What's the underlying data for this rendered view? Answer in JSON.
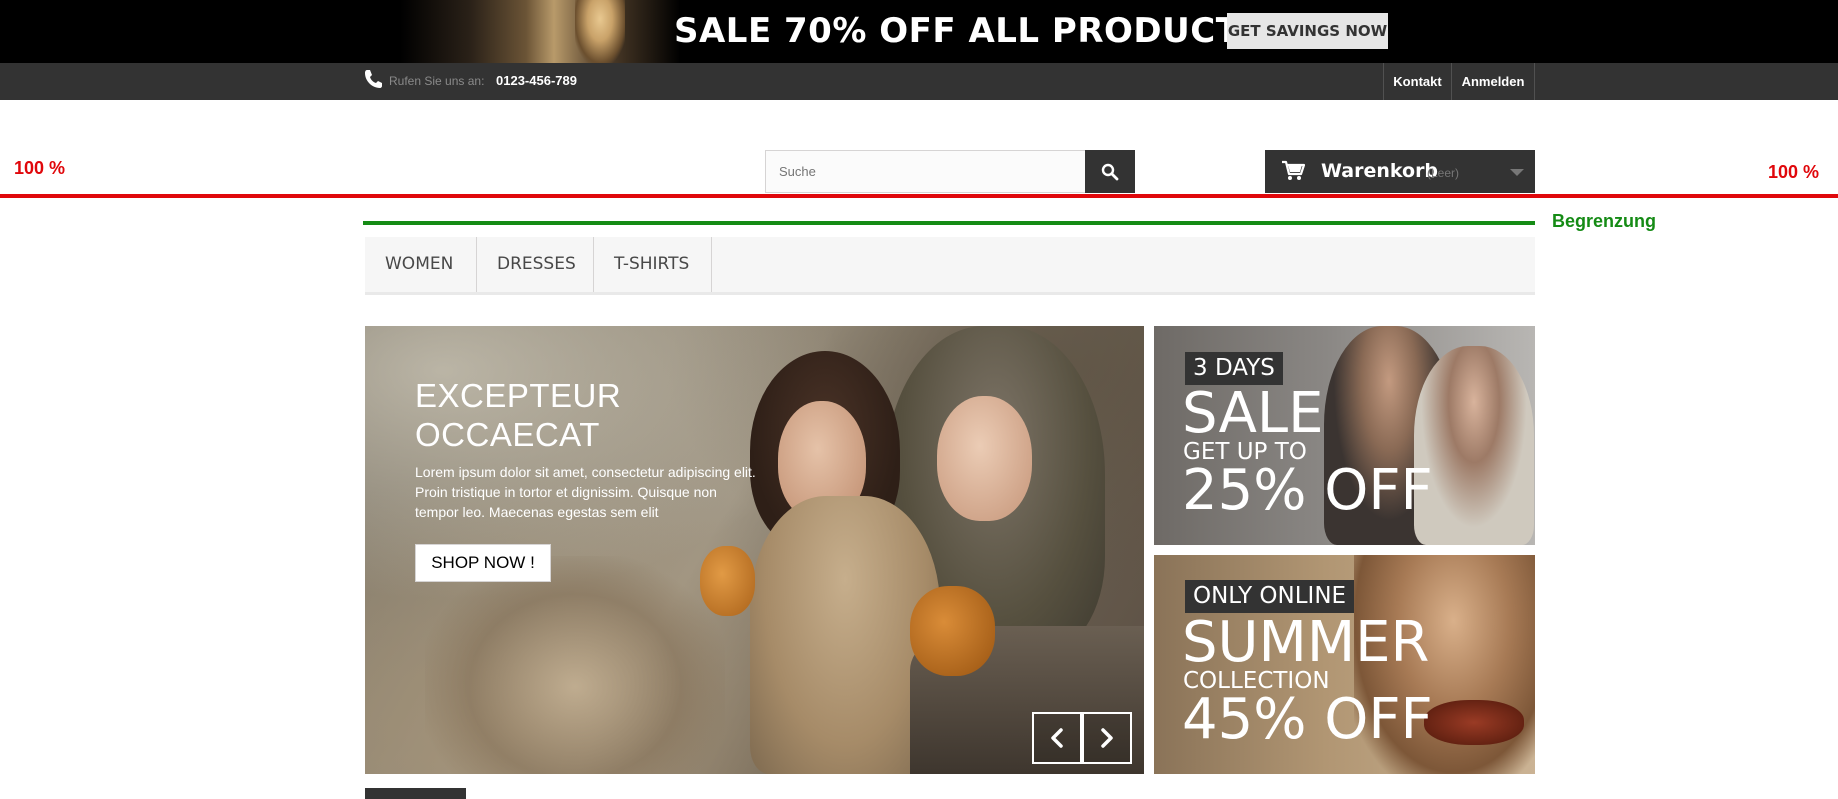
{
  "promo_banner": {
    "headline": "SALE 70% OFF ALL PRODUCTS",
    "button_label": "GET SAVINGS NOW"
  },
  "header_bar": {
    "call_label": "Rufen Sie uns an:",
    "phone_number": "0123-456-789",
    "links": [
      {
        "label": "Kontakt"
      },
      {
        "label": "Anmelden"
      }
    ]
  },
  "search": {
    "placeholder": "Suche",
    "value": ""
  },
  "cart": {
    "label": "Warenkorb",
    "status": "(Leer)"
  },
  "annotations": {
    "left_percent": "100 %",
    "right_percent": "100 %",
    "limit_label": "Begrenzung",
    "red_color": "#e0070b",
    "green_color": "#158b15"
  },
  "menu": {
    "items": [
      {
        "label": "WOMEN"
      },
      {
        "label": "DRESSES"
      },
      {
        "label": "T-SHIRTS"
      }
    ]
  },
  "hero": {
    "title_line1": "EXCEPTEUR",
    "title_line2": "OCCAECAT",
    "text": "Lorem ipsum dolor sit amet, consectetur adipiscing elit. Proin tristique in tortor et dignissim. Quisque non tempor leo. Maecenas egestas sem elit",
    "button_label": "SHOP NOW !"
  },
  "side_banners": [
    {
      "tag": "3 DAYS",
      "big": "SALE",
      "mid": "GET UP TO",
      "pct": "25% OFF"
    },
    {
      "tag": "ONLY ONLINE",
      "big": "SUMMER",
      "mid": "COLLECTION",
      "pct": "45% OFF"
    }
  ],
  "colors": {
    "dark": "#333333",
    "black": "#000000",
    "menu_bg": "#f6f6f6"
  },
  "icons": {
    "phone": "phone-icon",
    "search": "search-icon",
    "cart": "cart-icon",
    "prev": "chevron-left-icon",
    "next": "chevron-right-icon",
    "dropdown": "caret-down-icon"
  }
}
